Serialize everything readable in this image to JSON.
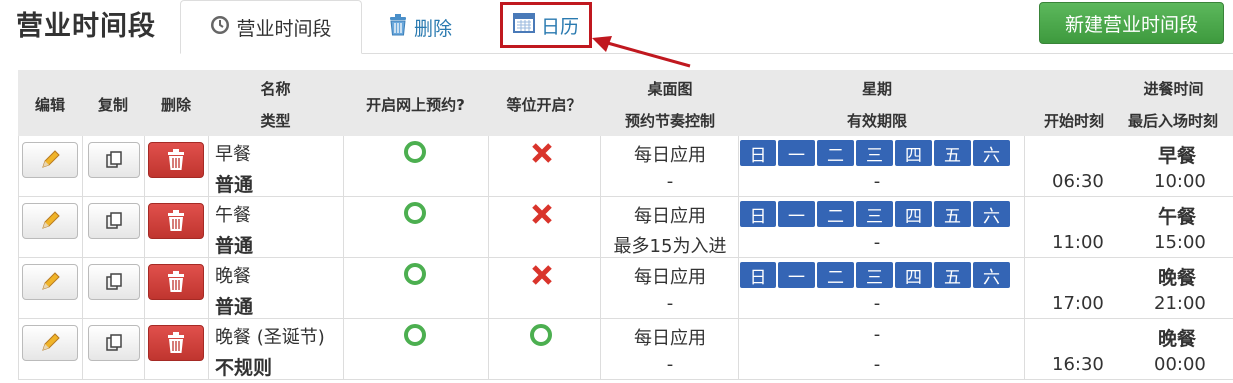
{
  "page_title": "营业时间段",
  "tabs": {
    "hours": "营业时间段",
    "delete": "删除",
    "calendar": "日历"
  },
  "new_button": "新建营业时间段",
  "colors": {
    "accent_red": "#c0181f",
    "day_blue": "#3465b5",
    "green": "#5cb85c"
  },
  "headers": {
    "edit": "编辑",
    "copy": "复制",
    "delete": "删除",
    "name": "名称",
    "type": "类型",
    "online": "开启网上预约?",
    "waitlist": "等位开启？",
    "table_map": "桌面图",
    "pacing": "预约节奏控制",
    "week": "星期",
    "validity": "有效期限",
    "meal_time": "进餐时间",
    "start": "开始时刻",
    "last_entry": "最后入场时刻"
  },
  "days": [
    "日",
    "一",
    "二",
    "三",
    "四",
    "五",
    "六"
  ],
  "rows": [
    {
      "name": "早餐",
      "type": "普通",
      "online": "yes",
      "waitlist": "no",
      "map": "每日应用",
      "pacing": "-",
      "week": true,
      "validity": "-",
      "meal": "早餐",
      "start": "06:30",
      "end": "10:00"
    },
    {
      "name": "午餐",
      "type": "普通",
      "online": "yes",
      "waitlist": "no",
      "map": "每日应用",
      "pacing": "最多15为入进",
      "week": true,
      "validity": "-",
      "meal": "午餐",
      "start": "11:00",
      "end": "15:00"
    },
    {
      "name": "晚餐",
      "type": "普通",
      "online": "yes",
      "waitlist": "no",
      "map": "每日应用",
      "pacing": "-",
      "week": true,
      "validity": "-",
      "meal": "晚餐",
      "start": "17:00",
      "end": "21:00"
    },
    {
      "name": "晚餐 (圣诞节)",
      "type": "不规则",
      "online": "yes",
      "waitlist": "yes",
      "map": "每日应用",
      "pacing": "-",
      "week_text": "-",
      "validity": "-",
      "meal": "晚餐",
      "start": "16:30",
      "end": "00:00"
    }
  ]
}
